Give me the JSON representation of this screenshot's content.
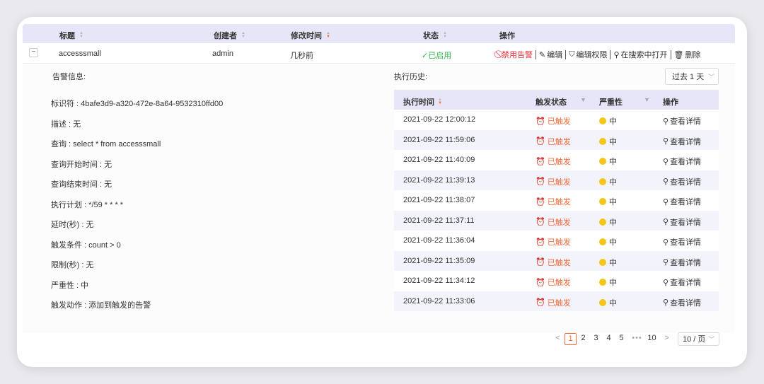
{
  "table": {
    "columns": {
      "title": "标题",
      "creator": "创建者",
      "modified": "修改时间",
      "status": "状态",
      "actions": "操作"
    },
    "row": {
      "expand_symbol": "−",
      "title": "accesssmall",
      "creator": "admin",
      "modified": "几秒前",
      "status": "✓已启用"
    },
    "ops": {
      "disable": "禁用告警",
      "edit": "编辑",
      "edit_perm": "编辑权限",
      "open_search": "在搜索中打开",
      "delete": "删除"
    }
  },
  "detail": {
    "alert_info_title": "告警信息:",
    "history_title": "执行历史:",
    "period": "过去 1 天",
    "info": [
      "标识符 : 4bafe3d9-a320-472e-8a64-9532310ffd00",
      "描述 : 无",
      "查询 : select * from accesssmall",
      "查询开始时间 : 无",
      "查询结束时间 : 无",
      "执行计划 : */59 * * * *",
      "延时(秒) : 无",
      "触发条件 : count > 0",
      "限制(秒) : 无",
      "严重性 : 中",
      "触发动作 : 添加到触发的告警"
    ]
  },
  "history": {
    "columns": {
      "time": "执行时间",
      "trigger": "触发状态",
      "severity": "严重性",
      "actions": "操作"
    },
    "rows": [
      {
        "time": "2021-09-22 12:00:12",
        "trigger": "已触发",
        "severity": "中",
        "action": "查看详情"
      },
      {
        "time": "2021-09-22 11:59:06",
        "trigger": "已触发",
        "severity": "中",
        "action": "查看详情"
      },
      {
        "time": "2021-09-22 11:40:09",
        "trigger": "已触发",
        "severity": "中",
        "action": "查看详情"
      },
      {
        "time": "2021-09-22 11:39:13",
        "trigger": "已触发",
        "severity": "中",
        "action": "查看详情"
      },
      {
        "time": "2021-09-22 11:38:07",
        "trigger": "已触发",
        "severity": "中",
        "action": "查看详情"
      },
      {
        "time": "2021-09-22 11:37:11",
        "trigger": "已触发",
        "severity": "中",
        "action": "查看详情"
      },
      {
        "time": "2021-09-22 11:36:04",
        "trigger": "已触发",
        "severity": "中",
        "action": "查看详情"
      },
      {
        "time": "2021-09-22 11:35:09",
        "trigger": "已触发",
        "severity": "中",
        "action": "查看详情"
      },
      {
        "time": "2021-09-22 11:34:12",
        "trigger": "已触发",
        "severity": "中",
        "action": "查看详情"
      },
      {
        "time": "2021-09-22 11:33:06",
        "trigger": "已触发",
        "severity": "中",
        "action": "查看详情"
      }
    ]
  },
  "pagination": {
    "prev": "<",
    "next": ">",
    "pages": [
      "1",
      "2",
      "3",
      "4",
      "5"
    ],
    "more": "•••",
    "last": "10",
    "page_size": "10 / 页",
    "current": "1"
  },
  "colors": {
    "accent": "#f26b3a",
    "header_bg": "#e7e6f8",
    "enabled_green": "#33b34a",
    "danger_red": "#e8333a",
    "severity_yellow": "#f5c518"
  }
}
